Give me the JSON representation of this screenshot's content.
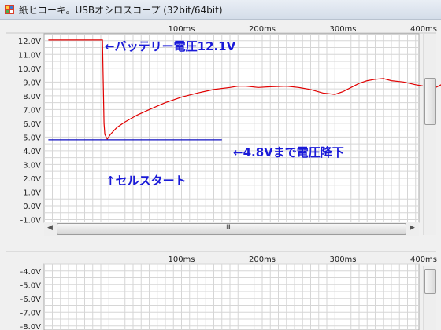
{
  "window": {
    "title": "紙ヒコーキ。USBオシロスコープ (32bit/64bit)",
    "app_icon": "window-app-icon"
  },
  "scope_top": {
    "y_ticks": [
      "12.0V",
      "11.0V",
      "10.0V",
      "9.0V",
      "8.0V",
      "7.0V",
      "6.0V",
      "5.0V",
      "4.0V",
      "3.0V",
      "2.0V",
      "1.0V",
      "0.0V",
      "-1.0V"
    ],
    "x_ticks": [
      "100ms",
      "200ms",
      "300ms",
      "400ms"
    ],
    "trace_color": "#e00000",
    "level_color": "#1010c0",
    "annotations": {
      "battery_voltage": "←バッテリー電圧12.1V",
      "voltage_drop": "←4.8Vまで電圧降下",
      "cell_start": "↑セルスタート"
    }
  },
  "scope_bottom": {
    "y_ticks": [
      "-4.0V",
      "-5.0V",
      "-6.0V",
      "-7.0V",
      "-8.0V"
    ],
    "x_ticks": [
      "100ms",
      "200ms",
      "300ms",
      "400ms"
    ]
  },
  "scrollbar": {
    "grip": "III"
  },
  "chart_data": {
    "type": "line",
    "title": "",
    "xlabel": "",
    "ylabel": "",
    "x_unit": "ms",
    "xlim": [
      -65,
      438
    ],
    "ylim": [
      -1.0,
      12.0
    ],
    "grid": true,
    "series": [
      {
        "x": [
          -65,
          0,
          2,
          3,
          4,
          5,
          8,
          12,
          20,
          30,
          45,
          60,
          80,
          100,
          120,
          140,
          160,
          170,
          180,
          195,
          210,
          230,
          245,
          260,
          275,
          290,
          300,
          310,
          320,
          330,
          340,
          350,
          360,
          375,
          390,
          405,
          415,
          425,
          435,
          438
        ],
        "y": [
          12.05,
          12.05,
          12.05,
          9.0,
          6.0,
          5.2,
          4.85,
          5.2,
          5.7,
          6.1,
          6.6,
          7.0,
          7.5,
          7.9,
          8.2,
          8.45,
          8.6,
          8.7,
          8.7,
          8.6,
          8.65,
          8.7,
          8.6,
          8.45,
          8.2,
          8.1,
          8.3,
          8.6,
          8.9,
          9.1,
          9.2,
          9.25,
          9.1,
          9.0,
          8.8,
          8.65,
          8.6,
          8.9,
          9.2,
          9.3
        ]
      },
      {
        "x": [
          -65,
          150
        ],
        "y": [
          4.8,
          4.8
        ]
      }
    ]
  }
}
